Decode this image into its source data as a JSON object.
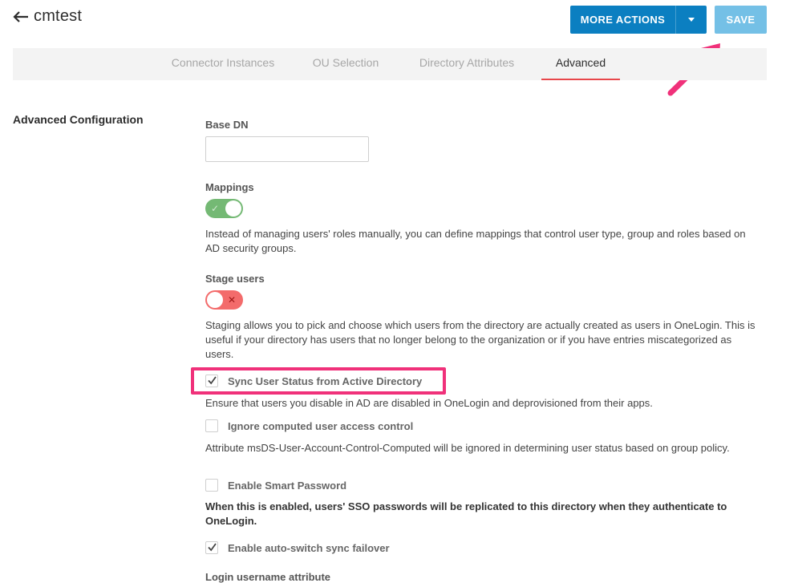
{
  "header": {
    "title": "cmtest",
    "more_actions_label": "MORE ACTIONS",
    "save_label": "SAVE"
  },
  "tabs": [
    {
      "label": "Connector Instances",
      "active": false
    },
    {
      "label": "OU Selection",
      "active": false
    },
    {
      "label": "Directory Attributes",
      "active": false
    },
    {
      "label": "Advanced",
      "active": true
    }
  ],
  "section": {
    "title": "Advanced Configuration"
  },
  "fields": {
    "base_dn": {
      "label": "Base DN",
      "value": "",
      "placeholder": ""
    },
    "mappings": {
      "label": "Mappings",
      "enabled": true,
      "help": "Instead of managing users' roles manually, you can define mappings that control user type, group and roles based on AD security groups."
    },
    "stage_users": {
      "label": "Stage users",
      "enabled": false,
      "help": "Staging allows you to pick and choose which users from the directory are actually created as users in OneLogin. This is useful if your directory has users that no longer belong to the organization or if you have entries miscategorized as users."
    },
    "sync_user_status": {
      "label": "Sync User Status from Active Directory",
      "checked": true,
      "help": "Ensure that users you disable in AD are disabled in OneLogin and deprovisioned from their apps."
    },
    "ignore_computed": {
      "label": "Ignore computed user access control",
      "checked": false,
      "help": "Attribute msDS-User-Account-Control-Computed will be ignored in determining user status based on group policy."
    },
    "smart_password": {
      "label": "Enable Smart Password",
      "checked": false,
      "help": "When this is enabled, users' SSO passwords will be replicated to this directory when they authenticate to OneLogin."
    },
    "auto_switch": {
      "label": "Enable auto-switch sync failover",
      "checked": true
    },
    "login_username": {
      "label": "Login username attribute"
    }
  },
  "colors": {
    "primary": "#0b7fc1",
    "save": "#74c0e6",
    "toggle_on": "#74b974",
    "toggle_off": "#f36b6b",
    "tab_active_underline": "#e8474b",
    "annotation": "#f0317a"
  },
  "icons": {
    "back": "arrow-left-icon",
    "caret": "caret-down-icon",
    "check": "check-icon",
    "toggle_on": "check-icon",
    "toggle_off": "x-icon"
  }
}
